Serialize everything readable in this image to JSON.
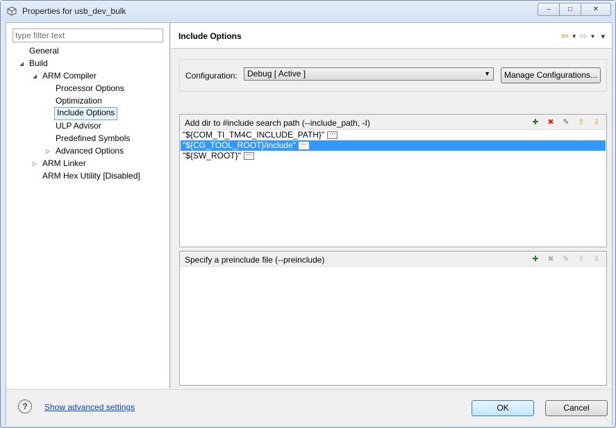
{
  "window": {
    "title": "Properties for usb_dev_bulk",
    "controls": {
      "minimize": "–",
      "maximize": "□",
      "close": "✕"
    }
  },
  "filter": {
    "placeholder": "type filter text"
  },
  "tree": {
    "general": "General",
    "build": "Build",
    "arm_compiler": "ARM Compiler",
    "processor_options": "Processor Options",
    "optimization": "Optimization",
    "include_options": "Include Options",
    "ulp_advisor": "ULP Advisor",
    "predefined_symbols": "Predefined Symbols",
    "advanced_options": "Advanced Options",
    "arm_linker": "ARM Linker",
    "arm_hex_utility": "ARM Hex Utility  [Disabled]"
  },
  "page": {
    "title": "Include Options",
    "nav": {
      "back": "⇦",
      "forward": "⇨",
      "menu": "▾"
    }
  },
  "configuration": {
    "label": "Configuration:",
    "selected": "Debug  [ Active ]",
    "manage_label": "Manage Configurations..."
  },
  "include_paths": {
    "title": "Add dir to #include search path (--include_path, -I)",
    "items": [
      "\"${COM_TI_TM4C_INCLUDE_PATH}\"",
      "\"${CG_TOOL_ROOT}/include\"",
      "\"${SW_ROOT}\""
    ],
    "selected_index": 1
  },
  "preinclude": {
    "title": "Specify a preinclude file (--preinclude)"
  },
  "footer": {
    "advanced_link": "Show advanced settings",
    "ok_label": "OK",
    "cancel_label": "Cancel",
    "help_glyph": "?"
  },
  "colors": {
    "selection": "#3399ff",
    "tree_selection": "#e5f3fb",
    "link": "#0a46cc"
  }
}
